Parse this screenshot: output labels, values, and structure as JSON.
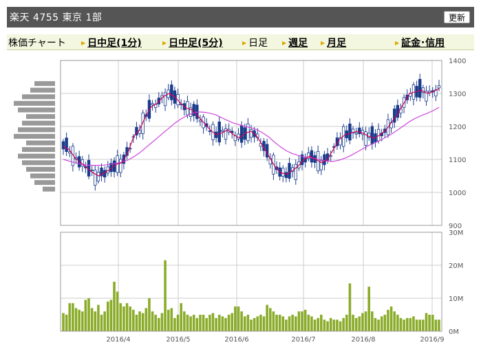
{
  "header": {
    "title": "楽天 4755 東京 1部",
    "refresh_label": "更新"
  },
  "tabs": [
    {
      "label": "株価チャート",
      "arrow": false,
      "link": false
    },
    {
      "label": "日中足(1分)",
      "arrow": true,
      "link": true
    },
    {
      "label": "日中足(5分)",
      "arrow": true,
      "link": true
    },
    {
      "label": "日足",
      "arrow": true,
      "link": false
    },
    {
      "label": "週足",
      "arrow": true,
      "link": true
    },
    {
      "label": "月足",
      "arrow": true,
      "link": true
    },
    {
      "label": "証金･信用",
      "arrow": true,
      "link": true
    }
  ],
  "colors": {
    "up": "#ffffff",
    "down": "#1a3c8c",
    "ma_short": "#d40055",
    "ma_long": "#cc44dd",
    "volume": "#8aac2a",
    "profile": "#999999",
    "grid": "#cccccc",
    "axis": "#999999"
  },
  "chart_data": [
    {
      "type": "candlestick",
      "ylim": [
        900,
        1400
      ],
      "y_ticks": [
        "900",
        "1000",
        "1100",
        "1200",
        "1300",
        "1400"
      ],
      "x_ticks": [
        "2016/4",
        "2016/5",
        "2016/6",
        "2016/7",
        "2016/8",
        "2016/9"
      ],
      "ma_short": [
        1140,
        1130,
        1105,
        1090,
        1075,
        1060,
        1050,
        1060,
        1070,
        1085,
        1090,
        1120,
        1170,
        1190,
        1230,
        1260,
        1270,
        1290,
        1300,
        1290,
        1270,
        1255,
        1250,
        1230,
        1210,
        1190,
        1175,
        1180,
        1190,
        1175,
        1165,
        1180,
        1185,
        1170,
        1140,
        1110,
        1080,
        1060,
        1055,
        1065,
        1080,
        1100,
        1110,
        1100,
        1090,
        1100,
        1130,
        1160,
        1175,
        1180,
        1185,
        1180,
        1170,
        1165,
        1175,
        1190,
        1215,
        1240,
        1270,
        1300,
        1305,
        1310,
        1300,
        1305,
        1315
      ],
      "ma_long": [
        1100,
        1095,
        1090,
        1086,
        1083,
        1082,
        1082,
        1083,
        1085,
        1088,
        1092,
        1098,
        1108,
        1120,
        1135,
        1150,
        1165,
        1180,
        1195,
        1210,
        1222,
        1232,
        1240,
        1244,
        1243,
        1240,
        1235,
        1226,
        1218,
        1210,
        1205,
        1200,
        1196,
        1190,
        1180,
        1168,
        1152,
        1138,
        1126,
        1118,
        1112,
        1108,
        1106,
        1102,
        1098,
        1095,
        1094,
        1098,
        1104,
        1112,
        1122,
        1132,
        1142,
        1150,
        1158,
        1168,
        1178,
        1190,
        1202,
        1215,
        1225,
        1233,
        1240,
        1248,
        1258
      ]
    },
    {
      "type": "bar",
      "name": "volume",
      "ylim": [
        0,
        30
      ],
      "y_ticks": [
        "0M",
        "10M",
        "20M",
        "30M"
      ],
      "values": [
        5.5,
        5,
        8.5,
        8.5,
        7,
        6.5,
        6,
        9.5,
        10,
        7,
        6,
        8,
        5,
        6,
        9,
        9.5,
        15,
        12,
        8.5,
        7.5,
        8.5,
        7.5,
        6.5,
        5,
        6,
        5.5,
        7,
        10,
        6,
        5,
        4,
        5.5,
        21.5,
        6.5,
        7,
        4,
        5,
        8.5,
        6,
        5,
        4.5,
        5,
        4,
        5,
        5,
        4,
        5,
        5.5,
        4,
        5,
        4.5,
        4,
        5,
        5.5,
        7.5,
        7.5,
        6,
        4.5,
        5,
        3.5,
        4,
        4.5,
        5,
        4.5,
        8,
        7,
        6,
        5,
        5,
        4.5,
        3.5,
        4.5,
        5,
        4.5,
        6,
        6,
        6.5,
        5,
        4.5,
        3.5,
        4,
        5,
        3.5,
        3,
        4,
        3.5,
        3.5,
        3,
        4,
        5,
        14.5,
        5,
        4,
        4.5,
        5.5,
        6,
        13.5,
        6,
        4,
        3.5,
        4.5,
        5,
        6.5,
        7.5,
        6,
        5,
        4,
        3.5,
        4,
        4,
        4.5,
        3.5,
        3.5,
        3.5,
        5.5,
        5,
        5,
        3.5,
        3.5
      ]
    },
    {
      "type": "bar",
      "name": "price-volume-profile",
      "orientation": "horizontal",
      "bin_prices": [
        1010,
        1030,
        1050,
        1070,
        1090,
        1110,
        1130,
        1150,
        1170,
        1190,
        1210,
        1230,
        1250,
        1270,
        1290,
        1310,
        1330
      ],
      "values": [
        6,
        10,
        12,
        14,
        16,
        18,
        16,
        14,
        20,
        18,
        16,
        14,
        18,
        20,
        16,
        12,
        10
      ]
    }
  ]
}
